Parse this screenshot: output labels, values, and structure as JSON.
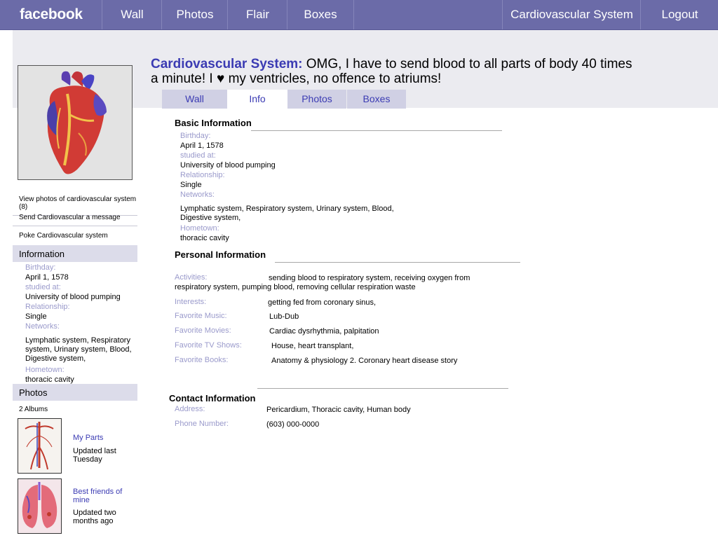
{
  "nav": {
    "logo": "facebook",
    "wall": "Wall",
    "photos": "Photos",
    "flair": "Flair",
    "boxes": "Boxes",
    "profile": "Cardiovascular System",
    "logout": "Logout"
  },
  "profile": {
    "name": "Cardiovascular System:",
    "status_part1": "OMG, I have to send blood to all parts of body  40 times a minute! I",
    "status_part2": "my ventricles, no offence to atriums!",
    "heart_glyph": "♥"
  },
  "tabs": [
    "Wall",
    "Info",
    "Photos",
    "Boxes"
  ],
  "sidebar": {
    "links": [
      "View photos of cardiovascular system (8)",
      "Send Cardiovascular a message",
      "Poke Cardiovascular system"
    ],
    "info_header": "Information",
    "info": {
      "birthday_label": "Birthday:",
      "birthday": "April 1, 1578",
      "studied_label": "studied at:",
      "studied": "University of blood pumping",
      "relationship_label": "Relationship:",
      "relationship": "Single",
      "networks_label": "Networks:",
      "networks": "Lymphatic system, Respiratory system, Urinary system, Blood, Digestive system,",
      "hometown_label": "Hometown:",
      "hometown": "thoracic cavity"
    },
    "photos_header": "Photos",
    "albums_count": "2 Albums",
    "albums": [
      {
        "title": "My Parts",
        "updated": "Updated last Tuesday"
      },
      {
        "title": "Best friends of mine",
        "updated": "Updated two months ago"
      }
    ]
  },
  "basic": {
    "title": "Basic Information",
    "birthday_label": "Birthday:",
    "birthday": "April 1, 1578",
    "studied_label": "studied at:",
    "studied": "University of blood pumping",
    "relationship_label": "Relationship:",
    "relationship": "Single",
    "networks_label": "Networks:",
    "networks": "Lymphatic system, Respiratory system, Urinary system, Blood, Digestive system,",
    "hometown_label": "Hometown:",
    "hometown": "thoracic cavity"
  },
  "personal": {
    "title": "Personal Information",
    "activities_label": "Activities:",
    "activities": "sending blood to respiratory system, receiving oxygen from",
    "activities_cont": "respiratory system, pumping blood, removing cellular respiration waste",
    "interests_label": "Interests:",
    "interests": "getting fed from coronary sinus,",
    "music_label": "Favorite Music:",
    "music": "Lub-Dub",
    "movies_label": "Favorite Movies:",
    "movies": "Cardiac dysrhythmia,  palpitation",
    "tv_label": "Favorite TV Shows:",
    "tv": "House, heart transplant,",
    "books_label": "Favorite Books:",
    "books": "Anatomy & physiology 2.  Coronary heart disease story"
  },
  "contact": {
    "title": "Contact Information",
    "address_label": "Address:",
    "address": "Pericardium, Thoracic cavity, Human body",
    "phone_label": "Phone Number:",
    "phone": "(603) 000-0000"
  },
  "colors": {
    "topbar": "#6b6ba8",
    "link": "#3b3bb3",
    "label": "#9a9acb",
    "band": "#ebebf0"
  }
}
